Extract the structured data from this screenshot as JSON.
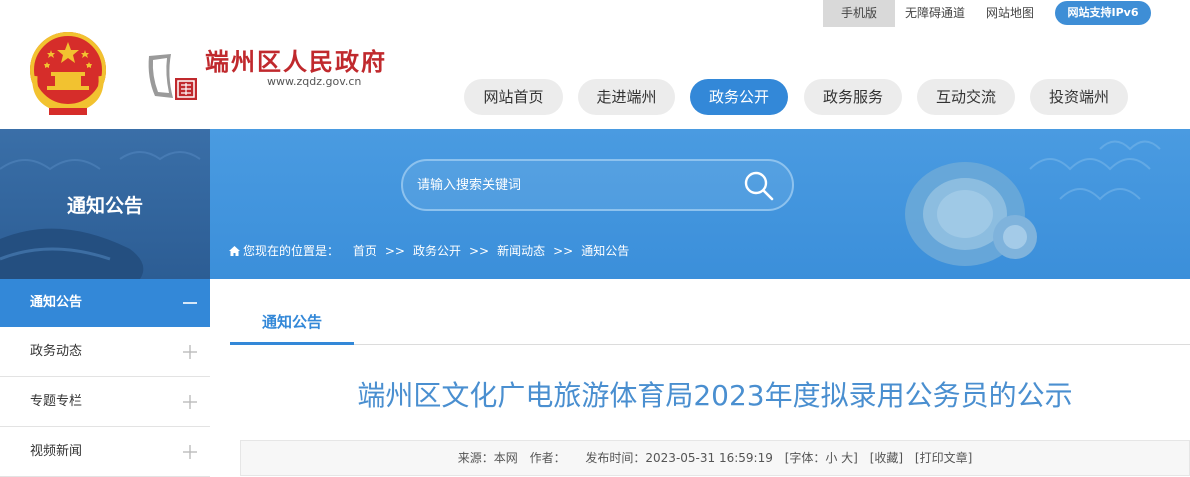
{
  "topbar": {
    "mobile": "手机版",
    "accessibility": "无障碍通道",
    "sitemap": "网站地图",
    "ipv6": "网站支持IPv6"
  },
  "header": {
    "site_name": "端州区人民政府",
    "site_url": "www.zqdz.gov.cn"
  },
  "nav": [
    {
      "label": "网站首页",
      "active": false
    },
    {
      "label": "走进端州",
      "active": false
    },
    {
      "label": "政务公开",
      "active": true
    },
    {
      "label": "政务服务",
      "active": false
    },
    {
      "label": "互动交流",
      "active": false
    },
    {
      "label": "投资端州",
      "active": false
    }
  ],
  "banner": {
    "section_title": "通知公告",
    "search_placeholder": "请输入搜索关键词",
    "breadcrumb_prefix": "您现在的位置是：",
    "breadcrumb": [
      "首页",
      "政务公开",
      "新闻动态",
      "通知公告"
    ],
    "breadcrumb_sep": ">>"
  },
  "sidebar": {
    "items": [
      {
        "label": "通知公告",
        "active": true
      },
      {
        "label": "政务动态",
        "active": false
      },
      {
        "label": "专题专栏",
        "active": false
      },
      {
        "label": "视频新闻",
        "active": false
      }
    ]
  },
  "content": {
    "tab": "通知公告",
    "title": "端州区文化广电旅游体育局2023年度拟录用公务员的公示",
    "meta": {
      "source": "来源：本网",
      "author": "作者：",
      "publish_time": "发布时间：2023-05-31 16:59:19",
      "font": "[字体：小 大]",
      "favorite": "[收藏]",
      "print": "[打印文章]"
    }
  },
  "colors": {
    "primary": "#3388d8",
    "banner": "#4a9be1",
    "brand_red": "#c0292d",
    "title_blue": "#4a8fd0"
  }
}
